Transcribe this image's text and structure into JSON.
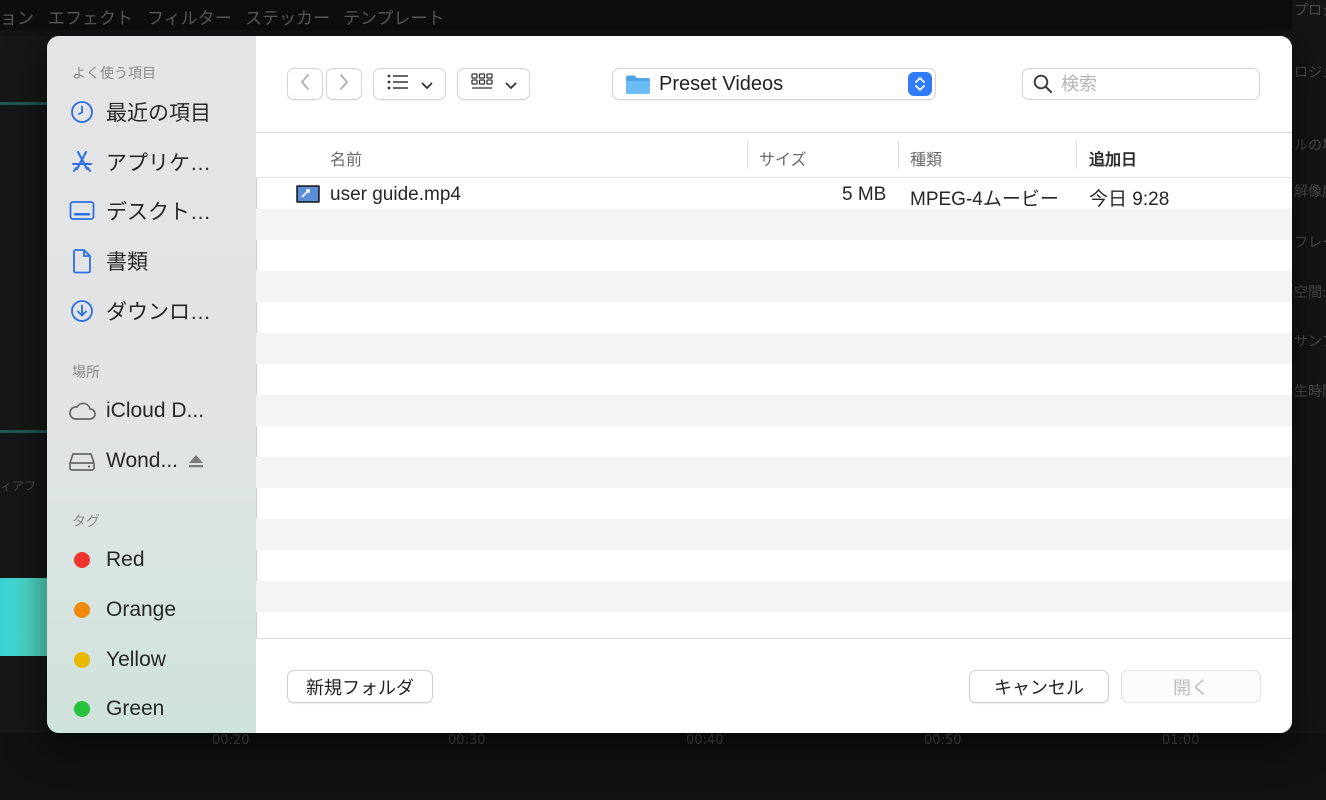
{
  "background": {
    "menu_items": [
      "ョン",
      "エフェクト",
      "フィルター",
      "ステッカー",
      "テンプレート"
    ],
    "right_panel_fragments": [
      "プロジェ",
      "ロジェ",
      "ルの場",
      "解像度:",
      "フレーム",
      "空間:",
      "サンプル",
      "生時間"
    ],
    "left_panel_fragment": "ィアフ",
    "timeline_labels": [
      "00:20",
      "00:30",
      "00:40",
      "00:50",
      "01:00"
    ]
  },
  "sidebar": {
    "favorites_title": "よく使う項目",
    "favorites": [
      {
        "icon": "clock-icon",
        "label": "最近の項目"
      },
      {
        "icon": "applications-icon",
        "label": "アプリケ…"
      },
      {
        "icon": "desktop-icon",
        "label": "デスクト…"
      },
      {
        "icon": "document-icon",
        "label": "書類"
      },
      {
        "icon": "downloads-icon",
        "label": "ダウンロ…"
      }
    ],
    "locations_title": "場所",
    "locations": [
      {
        "icon": "icloud-icon",
        "label": "iCloud D..."
      },
      {
        "icon": "drive-icon",
        "label": "Wond..."
      }
    ],
    "tags_title": "タグ",
    "tags": [
      {
        "label": "Red",
        "color": "#f0342c"
      },
      {
        "label": "Orange",
        "color": "#f08a0c"
      },
      {
        "label": "Yellow",
        "color": "#e8b700"
      },
      {
        "label": "Green",
        "color": "#27c23c"
      }
    ]
  },
  "toolbar": {
    "location": "Preset Videos",
    "search_placeholder": "検索"
  },
  "columns": {
    "name": "名前",
    "size": "サイズ",
    "kind": "種類",
    "date_added": "追加日"
  },
  "files": [
    {
      "name": "user guide.mp4",
      "size": "5 MB",
      "kind": "MPEG-4ムービー",
      "date_added": "今日 9:28"
    }
  ],
  "footer": {
    "new_folder": "新規フォルダ",
    "cancel": "キャンセル",
    "open": "開く"
  },
  "colors": {
    "accent": "#2f7cf6",
    "sidebar_icon": "#2b6fe0"
  }
}
